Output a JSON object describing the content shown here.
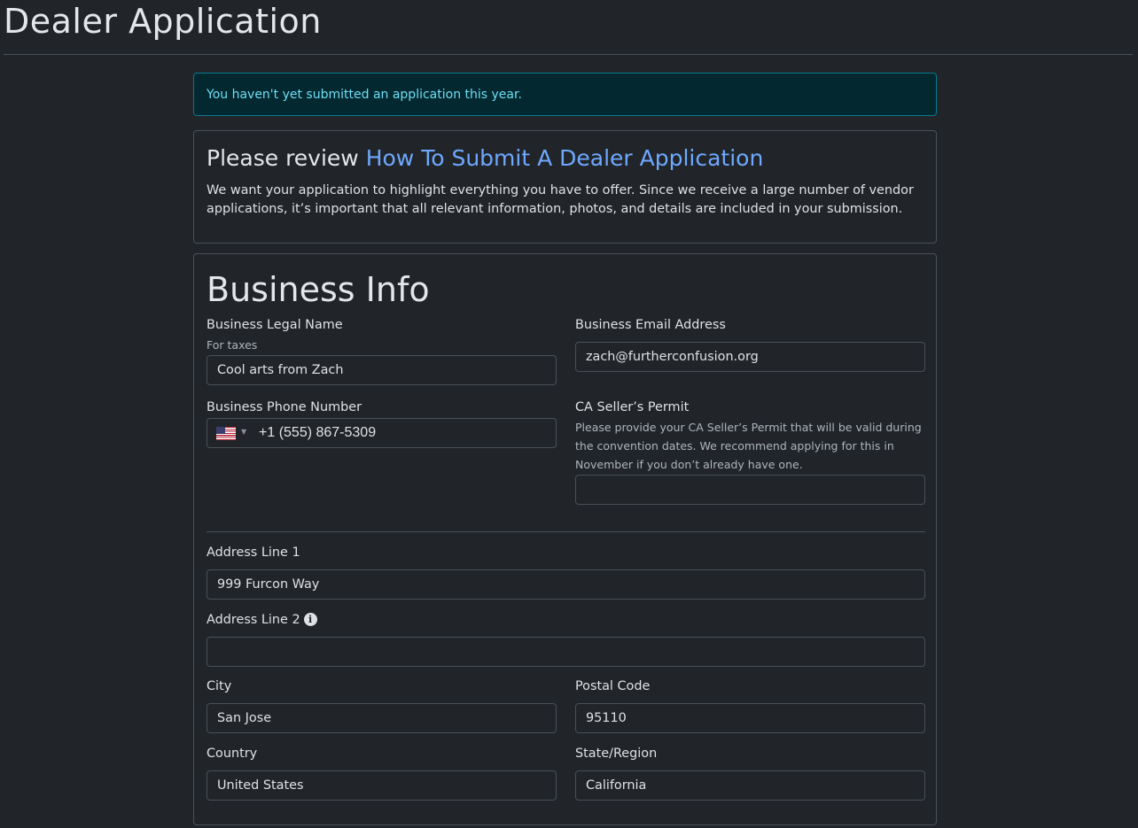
{
  "page": {
    "title": "Dealer Application"
  },
  "alert": {
    "text": "You haven't yet submitted an application this year."
  },
  "review": {
    "prefix": "Please review ",
    "link_text": "How To Submit A Dealer Application",
    "body": "We want your application to highlight everything you have to offer. Since we receive a large number of vendor applications, it’s important that all relevant information, photos, and details are included in your submission."
  },
  "business": {
    "section_title": "Business Info",
    "legal_name": {
      "label": "Business Legal Name",
      "hint": "For taxes",
      "value": "Cool arts from Zach"
    },
    "email": {
      "label": "Business Email Address",
      "value": "zach@furtherconfusion.org"
    },
    "phone": {
      "label": "Business Phone Number",
      "country_flag": "us-flag-icon",
      "value": "+1 (555) 867-5309"
    },
    "sellers_permit": {
      "label": "CA Seller’s Permit",
      "hint": "Please provide your CA Seller’s Permit that will be valid during the convention dates. We recommend applying for this in November if you don’t already have one.",
      "value": ""
    },
    "address1": {
      "label": "Address Line 1",
      "value": "999 Furcon Way"
    },
    "address2": {
      "label": "Address Line 2",
      "icon": "info-icon",
      "value": ""
    },
    "city": {
      "label": "City",
      "value": "San Jose"
    },
    "postal_code": {
      "label": "Postal Code",
      "value": "95110"
    },
    "country": {
      "label": "Country",
      "value": "United States"
    },
    "state": {
      "label": "State/Region",
      "value": "California"
    }
  },
  "colors": {
    "background": "#212529",
    "alert_bg": "#032830",
    "alert_border": "#087990",
    "alert_text": "#6edff6",
    "link": "#6ea8fe",
    "border": "#495057"
  }
}
